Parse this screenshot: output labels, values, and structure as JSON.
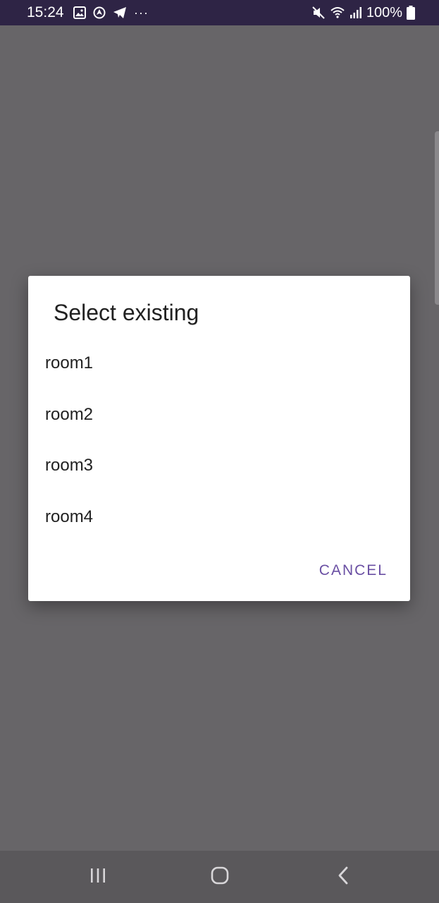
{
  "status_bar": {
    "time": "15:24",
    "battery": "100%",
    "more": "···",
    "icons": [
      "image-icon",
      "shield-icon",
      "telegram-icon",
      "mute-icon",
      "wifi-icon",
      "signal-icon",
      "battery-icon"
    ],
    "background": "#2e2445"
  },
  "dialog": {
    "title": "Select existing",
    "items": [
      {
        "label": "room1"
      },
      {
        "label": "room2"
      },
      {
        "label": "room3"
      },
      {
        "label": "room4"
      }
    ],
    "cancel_label": "CANCEL",
    "accent_color": "#6a4fa3"
  },
  "nav_bar": {
    "buttons": [
      "recents-icon",
      "home-icon",
      "back-icon"
    ]
  }
}
